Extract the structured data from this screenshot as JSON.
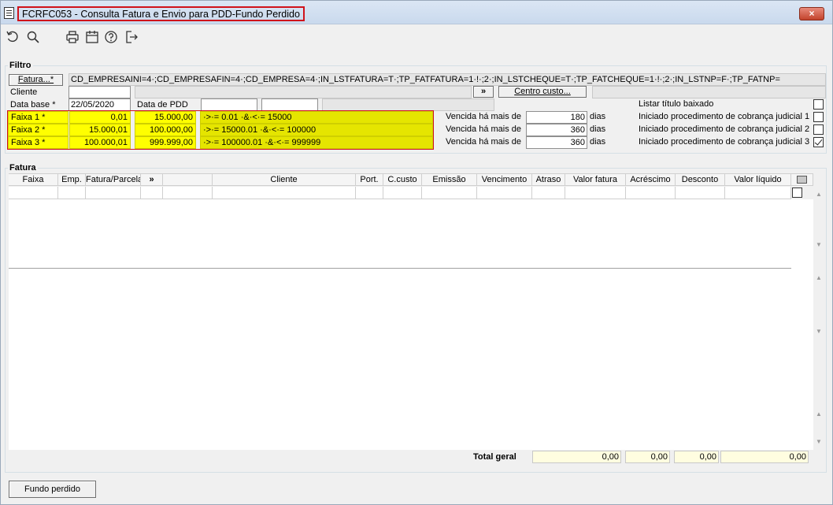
{
  "window": {
    "title": "FCRFC053 - Consulta Fatura e Envio para PDD-Fundo Perdido",
    "close_label": "×"
  },
  "toolbar": {
    "icons": [
      "undo-icon",
      "search-icon",
      "print-icon",
      "calendar-icon",
      "help-icon",
      "exit-icon"
    ]
  },
  "filtro": {
    "group_label": "Filtro",
    "fatura_button": "Fatura...*",
    "fatura_query": "CD_EMPRESAINI=4·;CD_EMPRESAFIN=4·;CD_EMPRESA=4·;IN_LSTFATURA=T·;TP_FATFATURA=1·!·;2·;IN_LSTCHEQUE=T·;TP_FATCHEQUE=1·!·;2·;IN_LSTNP=F·;TP_FATNP=",
    "cliente_label": "Cliente",
    "cliente_value": "",
    "more_button": "»",
    "centro_custo_button": "Centro custo...",
    "data_base_label": "Data base *",
    "data_base_value": "22/05/2020",
    "data_pdd_label": "Data de PDD",
    "data_pdd_value": "",
    "listar_label": "Listar título baixado",
    "listar_checked": false,
    "faixas": [
      {
        "label": "Faixa 1 *",
        "from": "0,01",
        "to": "15.000,00",
        "expr": "·>·= 0.01 ·&·<·= 15000",
        "vencida_label": "Vencida há mais de",
        "dias_value": "180",
        "dias_label": "dias",
        "proc_label": "Iniciado procedimento de cobrança judicial 1",
        "proc_checked": false
      },
      {
        "label": "Faixa 2 *",
        "from": "15.000,01",
        "to": "100.000,00",
        "expr": "·>·= 15000.01 ·&·<·= 100000",
        "vencida_label": "Vencida há mais de",
        "dias_value": "360",
        "dias_label": "dias",
        "proc_label": "Iniciado procedimento de cobrança judicial 2",
        "proc_checked": false
      },
      {
        "label": "Faixa 3 *",
        "from": "100.000,01",
        "to": "999.999,00",
        "expr": "·>·= 100000.01 ·&·<·= 999999",
        "vencida_label": "Vencida há mais de",
        "dias_value": "360",
        "dias_label": "dias",
        "proc_label": "Iniciado procedimento de cobrança judicial 3",
        "proc_checked": true
      }
    ]
  },
  "fatura": {
    "group_label": "Fatura",
    "columns": [
      "Faixa",
      "Emp.",
      "Fatura/Parcela",
      "»",
      "",
      "Cliente",
      "Port.",
      "C.custo",
      "Emissão",
      "Vencimento",
      "Atraso",
      "Valor fatura",
      "Acréscimo",
      "Desconto",
      "Valor líquido"
    ],
    "total_label": "Total geral",
    "totals": {
      "valor_fatura": "0,00",
      "acrescimo": "0,00",
      "desconto": "0,00",
      "valor_liquido": "0,00"
    }
  },
  "footer": {
    "fundo_perdido_button": "Fundo perdido"
  }
}
